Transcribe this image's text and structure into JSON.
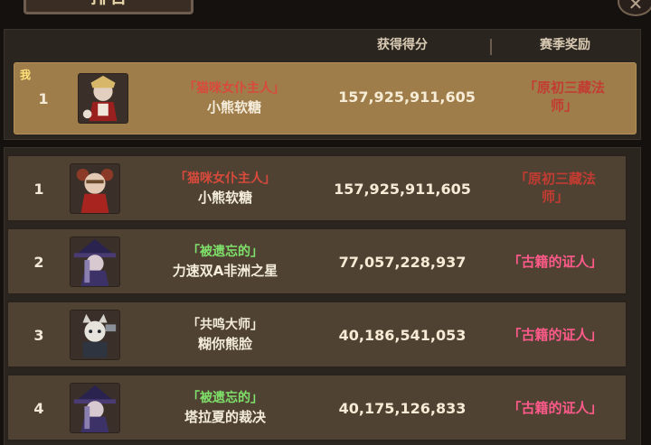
{
  "window": {
    "title": "排名",
    "close_glyph": "✕"
  },
  "header": {
    "col_score": "获得得分",
    "col_reward": "赛季奖励"
  },
  "my_entry": {
    "me_label": "我",
    "rank": "1",
    "title": "「猫咪女仆主人」",
    "name": "小熊软糖",
    "score": "157,925,911,605",
    "reward_line1": "「原初三藏法",
    "reward_line2": "师」"
  },
  "entries": [
    {
      "rank": "1",
      "title": "「猫咪女仆主人」",
      "name": "小熊软糖",
      "score": "157,925,911,605",
      "reward_line1": "「原初三藏法",
      "reward_line2": "师」"
    },
    {
      "rank": "2",
      "title": "「被遗忘的」",
      "name": "力速双A非洲之星",
      "score": "77,057,228,937",
      "reward_line1": "「古籍的证人」",
      "reward_line2": ""
    },
    {
      "rank": "3",
      "title": "「共鸣大师」",
      "name": "糊你熊脸",
      "score": "40,186,541,053",
      "reward_line1": "「古籍的证人」",
      "reward_line2": ""
    },
    {
      "rank": "4",
      "title": "「被遗忘的」",
      "name": "塔拉夏的裁决",
      "score": "40,175,126,833",
      "reward_line1": "「古籍的证人」",
      "reward_line2": ""
    }
  ],
  "colors": {
    "title_red": "#d84a3c",
    "title_green": "#7fe06a",
    "title_white": "#f4ecdb",
    "reward_red": "#c23c32",
    "reward_pink": "#ff5a8a"
  }
}
